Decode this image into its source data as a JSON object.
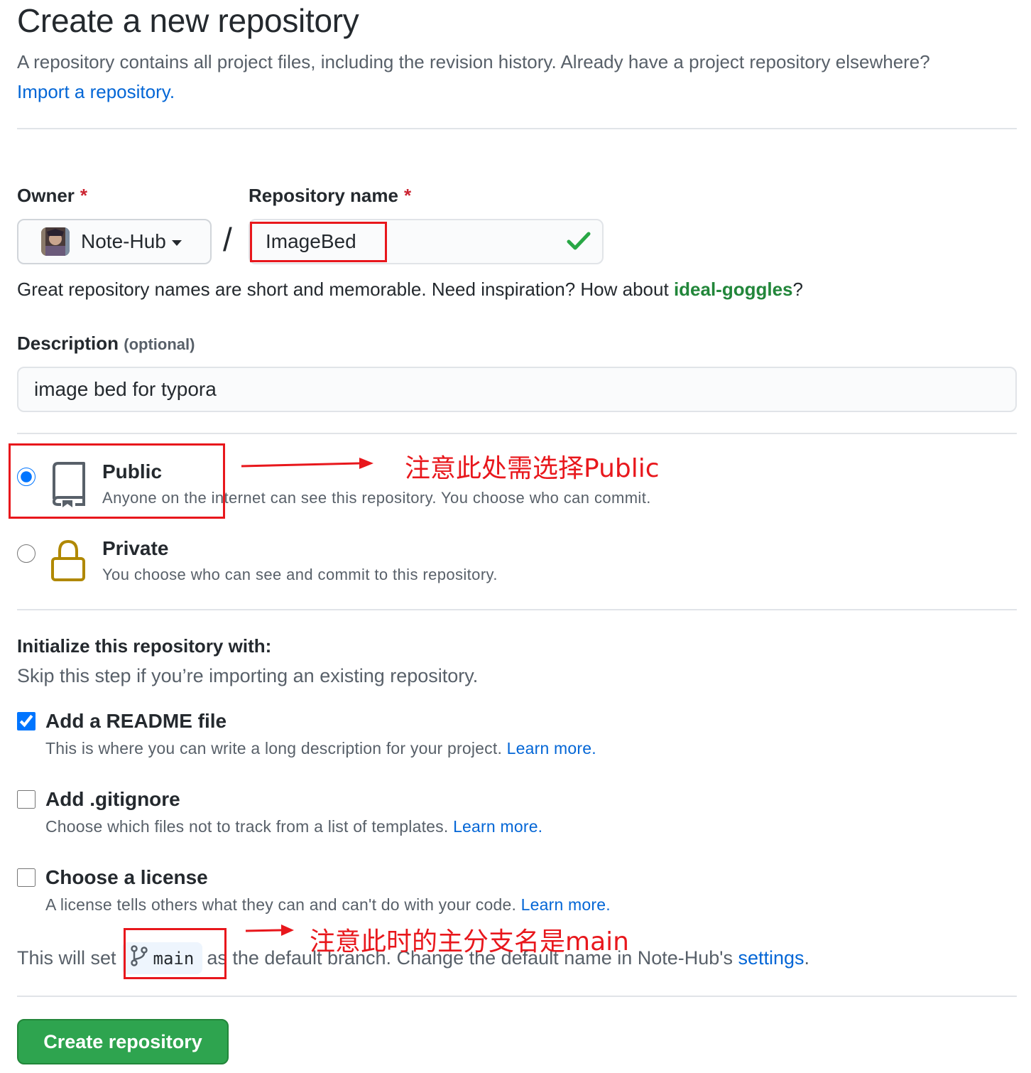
{
  "header": {
    "title": "Create a new repository",
    "subtitle": "A repository contains all project files, including the revision history. Already have a project repository elsewhere?",
    "import_link": "Import a repository."
  },
  "form": {
    "owner_label": "Owner",
    "required_mark": "*",
    "owner_name": "Note-Hub",
    "slash": "/",
    "repo_name_label": "Repository name",
    "repo_name_value": "ImageBed",
    "name_hint": "Great repository names are short and memorable. Need inspiration? How about",
    "name_suggestion": "ideal-goggles",
    "name_hint_end": "?",
    "description_label": "Description",
    "description_optional": "(optional)",
    "description_value": "image bed for typora"
  },
  "visibility": {
    "public": {
      "title": "Public",
      "description": "Anyone on the internet can see this repository. You choose who can commit.",
      "selected": true
    },
    "private": {
      "title": "Private",
      "description": "You choose who can see and commit to this repository.",
      "selected": false
    }
  },
  "initialize": {
    "title": "Initialize this repository with:",
    "description": "Skip this step if you’re importing an existing repository.",
    "options": [
      {
        "title": "Add a README file",
        "description": "This is where you can write a long description for your project.",
        "link": "Learn more.",
        "checked": true
      },
      {
        "title": "Add .gitignore",
        "description": "Choose which files not to track from a list of templates.",
        "link": "Learn more.",
        "checked": false
      },
      {
        "title": "Choose a license",
        "description": "A license tells others what they can and can't do with your code.",
        "link": "Learn more.",
        "checked": false
      }
    ]
  },
  "branch": {
    "prefix": "This will set",
    "name": "main",
    "suffix": "as the default branch. Change the default name in Note-Hub's",
    "settings_link": "settings",
    "end": "."
  },
  "create_button": "Create repository",
  "annotations": {
    "public_note": "注意此处需选择Public",
    "branch_note": "注意此时的主分支名是main"
  },
  "colors": {
    "link": "#0366d6",
    "primary_button": "#2ea44f",
    "suggestion": "#22863a",
    "annotation": "#e8171c",
    "lock_icon": "#b08800"
  }
}
